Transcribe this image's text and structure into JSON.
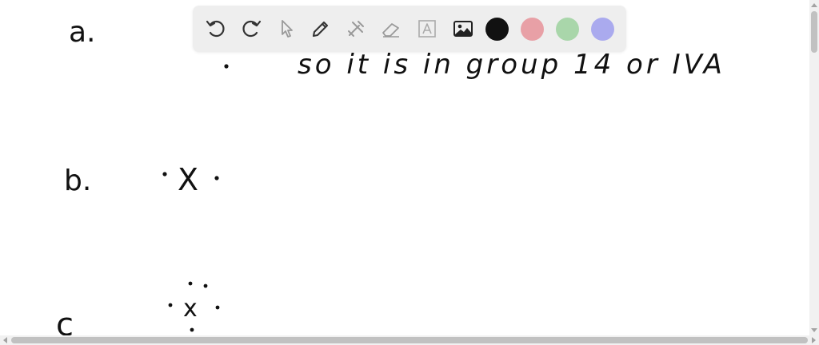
{
  "notes": {
    "label_a": "a.",
    "line_a": "so it is in group 14 or IVA",
    "label_b": "b.",
    "symbol_b": "X",
    "label_c": "c",
    "symbol_c": "x"
  },
  "toolbar": {
    "tools": [
      {
        "name": "undo",
        "icon": "undo-icon"
      },
      {
        "name": "redo",
        "icon": "redo-icon"
      },
      {
        "name": "select",
        "icon": "pointer-icon"
      },
      {
        "name": "pen",
        "icon": "pen-icon"
      },
      {
        "name": "tools",
        "icon": "tools-icon"
      },
      {
        "name": "eraser",
        "icon": "eraser-icon"
      },
      {
        "name": "text",
        "icon": "text-icon"
      },
      {
        "name": "image",
        "icon": "image-icon"
      }
    ],
    "colors": [
      "#111111",
      "#e8a0a6",
      "#a9d6aa",
      "#aaaaee"
    ]
  }
}
